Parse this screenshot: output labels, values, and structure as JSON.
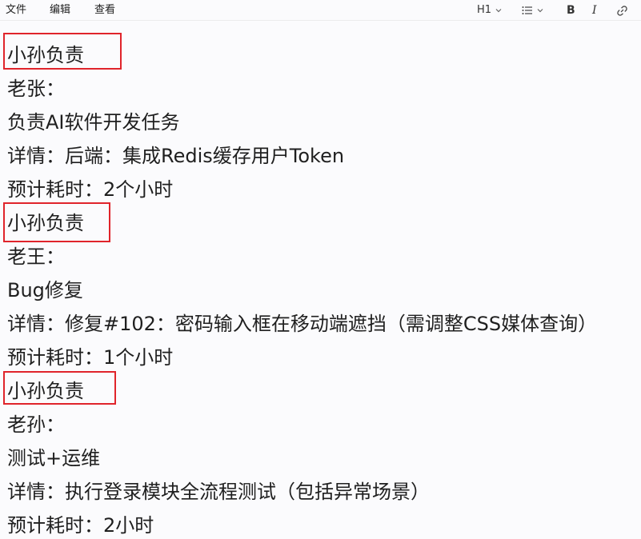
{
  "menubar": {
    "items": [
      "文件",
      "编辑",
      "查看"
    ]
  },
  "toolbar": {
    "heading_label": "H1",
    "heading_icon": "chevron-down-icon",
    "list_icon": "bulleted-list-icon",
    "list_chevron_icon": "chevron-down-icon",
    "bold_label": "B",
    "italic_label": "I",
    "link_icon": "link-icon"
  },
  "document": {
    "lines": [
      "小孙负责",
      "老张：",
      "负责AI软件开发任务",
      "详情：后端：集成Redis缓存用户Token",
      "预计耗时：2个小时",
      "小孙负责",
      "老王：",
      "Bug修复",
      "详情：修复#102：密码输入框在移动端遮挡（需调整CSS媒体查询）",
      "预计耗时：1个小时",
      "小孙负责",
      "老孙：",
      "测试+运维",
      "详情：执行登录模块全流程测试（包括异常场景）",
      "预计耗时：2小时"
    ]
  },
  "colors": {
    "highlight_border": "#e0242b",
    "background": "#fbfbfd",
    "text": "#1f1f1f"
  }
}
